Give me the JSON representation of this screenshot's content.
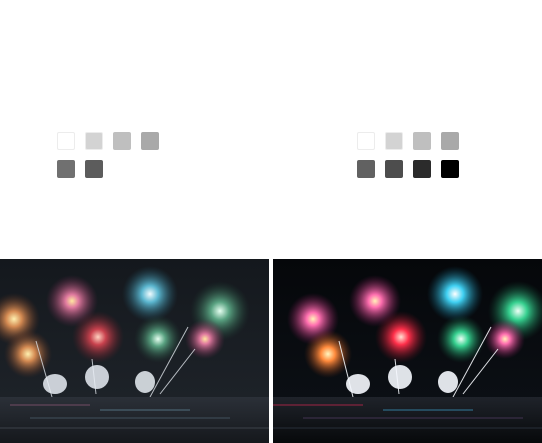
{
  "panels": {
    "left": {
      "swatches": [
        {
          "color": "#ffffff"
        },
        {
          "color": "#d3d3d3"
        },
        {
          "color": "#bfbfbf"
        },
        {
          "color": "#a9a9a9"
        },
        {
          "color": "#707070"
        },
        {
          "color": "#5c5c5c"
        }
      ]
    },
    "right": {
      "swatches": [
        {
          "color": "#ffffff"
        },
        {
          "color": "#d3d3d3"
        },
        {
          "color": "#bfbfbf"
        },
        {
          "color": "#a9a9a9"
        },
        {
          "color": "#616161"
        },
        {
          "color": "#4d4d4d"
        },
        {
          "color": "#2b2b2b"
        },
        {
          "color": "#000000"
        }
      ]
    }
  },
  "photos": {
    "left": {
      "subject": "fireworks-over-water",
      "tone": "original"
    },
    "right": {
      "subject": "fireworks-over-water",
      "tone": "adjusted"
    }
  }
}
